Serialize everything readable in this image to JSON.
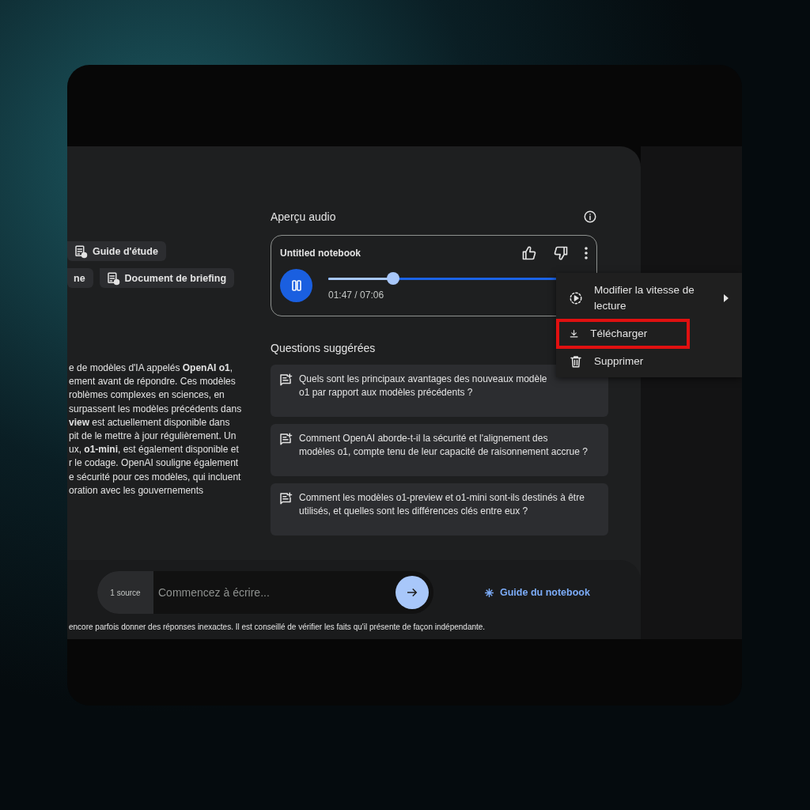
{
  "chips": [
    {
      "label": "Guide d'étude",
      "icon": true
    },
    {
      "label": "ne",
      "icon": false
    },
    {
      "label": "Document de briefing",
      "icon": true
    }
  ],
  "summary_lines": [
    "e de modèles d'IA appelés **OpenAI o1**,",
    "ement avant de répondre. Ces modèles",
    "roblèmes complexes en sciences, en",
    "surpassent les modèles précédents dans",
    "**view** est actuellement disponible dans",
    "pit de le mettre à jour régulièrement. Un",
    "ux, **o1-mini**, est également disponible et",
    "r le codage. OpenAI souligne également",
    "e sécurité pour ces modèles, qui incluent",
    "oration avec les gouvernements"
  ],
  "audio_overview": {
    "title": "Aperçu audio",
    "player": {
      "name": "Untitled notebook",
      "playing": true,
      "level": 0.25,
      "time": "01:47 / 07:06"
    }
  },
  "suggested_questions": {
    "title": "Questions suggérées",
    "items": [
      [
        "Quels sont les principaux avantages des nouveaux modèle",
        "o1 par rapport aux modèles précédents ?"
      ],
      [
        "Comment OpenAI aborde-t-il la sécurité et l'alignement des",
        "modèles o1, compte tenu de leur capacité de raisonnement accrue ?"
      ],
      [
        "Comment les modèles o1-preview et o1-mini sont-ils destinés à être",
        "utilisés, et quelles sont les différences clés entre eux ?"
      ]
    ]
  },
  "menu": {
    "items": [
      {
        "label": "Modifier la vitesse de lecture",
        "kind": "speed",
        "highlighted": false
      },
      {
        "label": "Télécharger",
        "kind": "download",
        "highlighted": true
      },
      {
        "label": "Supprimer",
        "kind": "delete",
        "highlighted": false
      }
    ]
  },
  "chat": {
    "source_count": "1 source",
    "placeholder": "Commencez à écrire...",
    "guide_link": "Guide du notebook"
  },
  "disclaimer": "encore parfois donner des réponses inexactes. Il est conseillé de vérifier les faits qu'il présente de façon indépendante."
}
